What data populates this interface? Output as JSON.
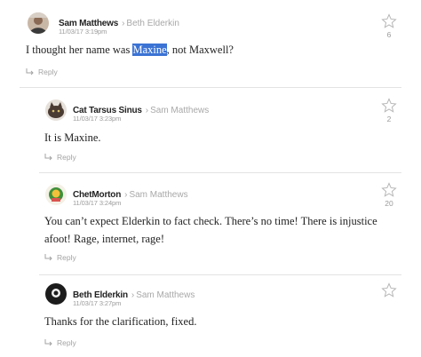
{
  "colors": {
    "highlight": "#3b73d4",
    "muted": "#a3a3a3",
    "divider": "#e3e3e3"
  },
  "comments": [
    {
      "author": "Sam Matthews",
      "reply_to": "Beth Elderkin",
      "timestamp": "11/03/17 3:19pm",
      "text_before": "I thought her name was ",
      "text_highlight": "Maxine",
      "text_after": ", not Maxwell?",
      "reply_label": "Reply",
      "star_count": "6",
      "avatar_icon": "user-photo-avatar"
    },
    {
      "author": "Cat Tarsus Sinus",
      "reply_to": "Sam Matthews",
      "timestamp": "11/03/17 3:23pm",
      "text": "It is Maxine.",
      "reply_label": "Reply",
      "star_count": "2",
      "avatar_icon": "cat-avatar"
    },
    {
      "author": "ChetMorton",
      "reply_to": "Sam Matthews",
      "timestamp": "11/03/17 3:24pm",
      "text_line1": "You can’t expect Elderkin to fact check. There’s no time! There is injustice",
      "text_line2": "afoot! Rage, internet, rage!",
      "reply_label": "Reply",
      "star_count": "20",
      "avatar_icon": "cartoon-avatar"
    },
    {
      "author": "Beth Elderkin",
      "reply_to": "Sam Matthews",
      "timestamp": "11/03/17 3:27pm",
      "text": "Thanks for the clarification, fixed.",
      "reply_label": "Reply",
      "star_count": "",
      "avatar_icon": "dark-avatar"
    }
  ]
}
